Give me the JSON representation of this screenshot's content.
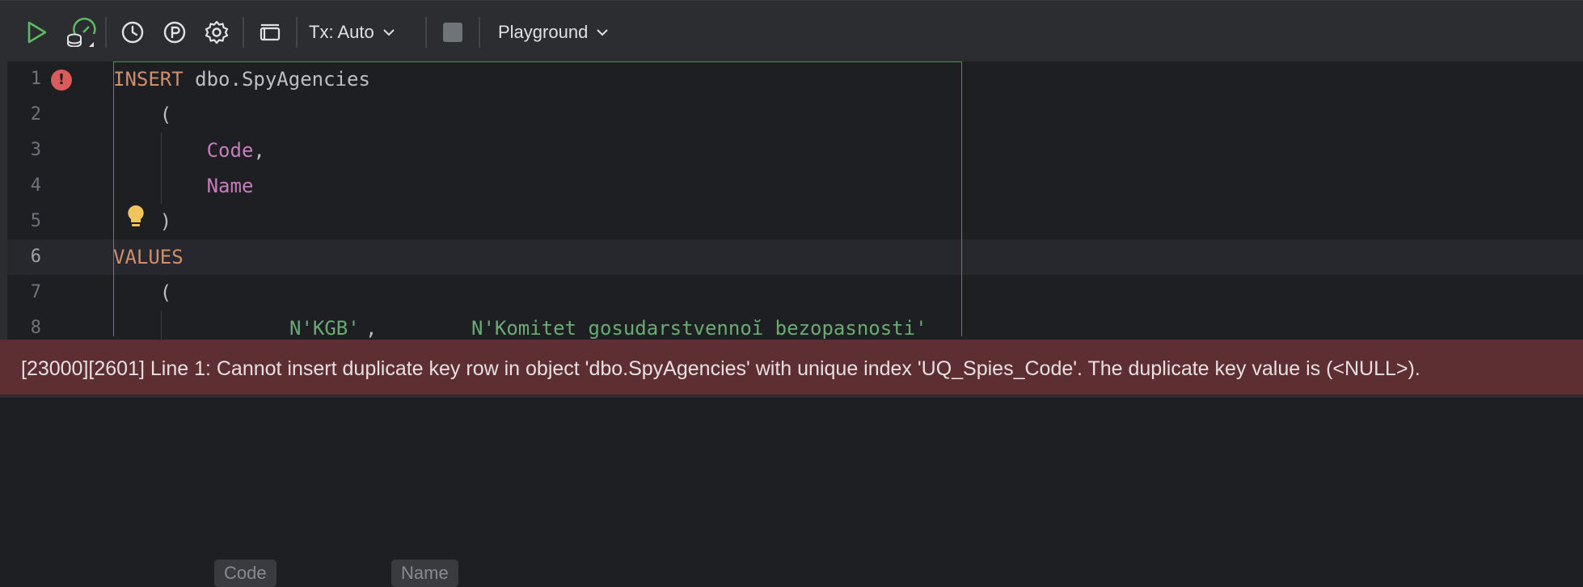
{
  "toolbar": {
    "run_icon": "play-icon",
    "datasource_icon": "database-gauge-icon",
    "history_icon": "clock-icon",
    "params_icon": "parameter-p-icon",
    "settings_icon": "gear-icon",
    "layout_icon": "output-panel-icon",
    "tx_label": "Tx: Auto",
    "stop_icon": "stop-square-icon",
    "session_label": "Playground",
    "colors": {
      "run": "#5fb865",
      "accent": "#5c8a4f"
    }
  },
  "editor": {
    "lines": [
      {
        "num": "1",
        "tokens": [
          {
            "t": "INSERT",
            "c": "kw"
          },
          {
            "t": " dbo.SpyAgencies",
            "c": "plain"
          }
        ]
      },
      {
        "num": "2",
        "tokens": [
          {
            "t": "    (",
            "c": "plain"
          }
        ]
      },
      {
        "num": "3",
        "tokens": [
          {
            "t": "        ",
            "c": "plain"
          },
          {
            "t": "Code",
            "c": "col"
          },
          {
            "t": ",",
            "c": "plain"
          }
        ]
      },
      {
        "num": "4",
        "tokens": [
          {
            "t": "        ",
            "c": "plain"
          },
          {
            "t": "Name",
            "c": "col"
          }
        ]
      },
      {
        "num": "5",
        "tokens": [
          {
            "t": "    )",
            "c": "plain"
          }
        ]
      },
      {
        "num": "6",
        "tokens": [
          {
            "t": "VALUES",
            "c": "kw"
          }
        ]
      },
      {
        "num": "7",
        "tokens": [
          {
            "t": "    (",
            "c": "plain"
          }
        ]
      },
      {
        "num": "8",
        "tokens": []
      }
    ],
    "line8": {
      "hint_code": "Code",
      "value_code": "N'KGB'",
      "comma": ", ",
      "hint_name": "Name",
      "value_name": "N'Komitet gosudarstvennoĭ bezopasnosti'"
    },
    "error_gutter_icon": "error-exclamation-icon",
    "intention_icon": "lightbulb-icon"
  },
  "error": {
    "message": "[23000][2601] Line 1: Cannot insert duplicate key row in object 'dbo.SpyAgencies' with unique index 'UQ_Spies_Code'. The duplicate key value is (<NULL>)."
  }
}
